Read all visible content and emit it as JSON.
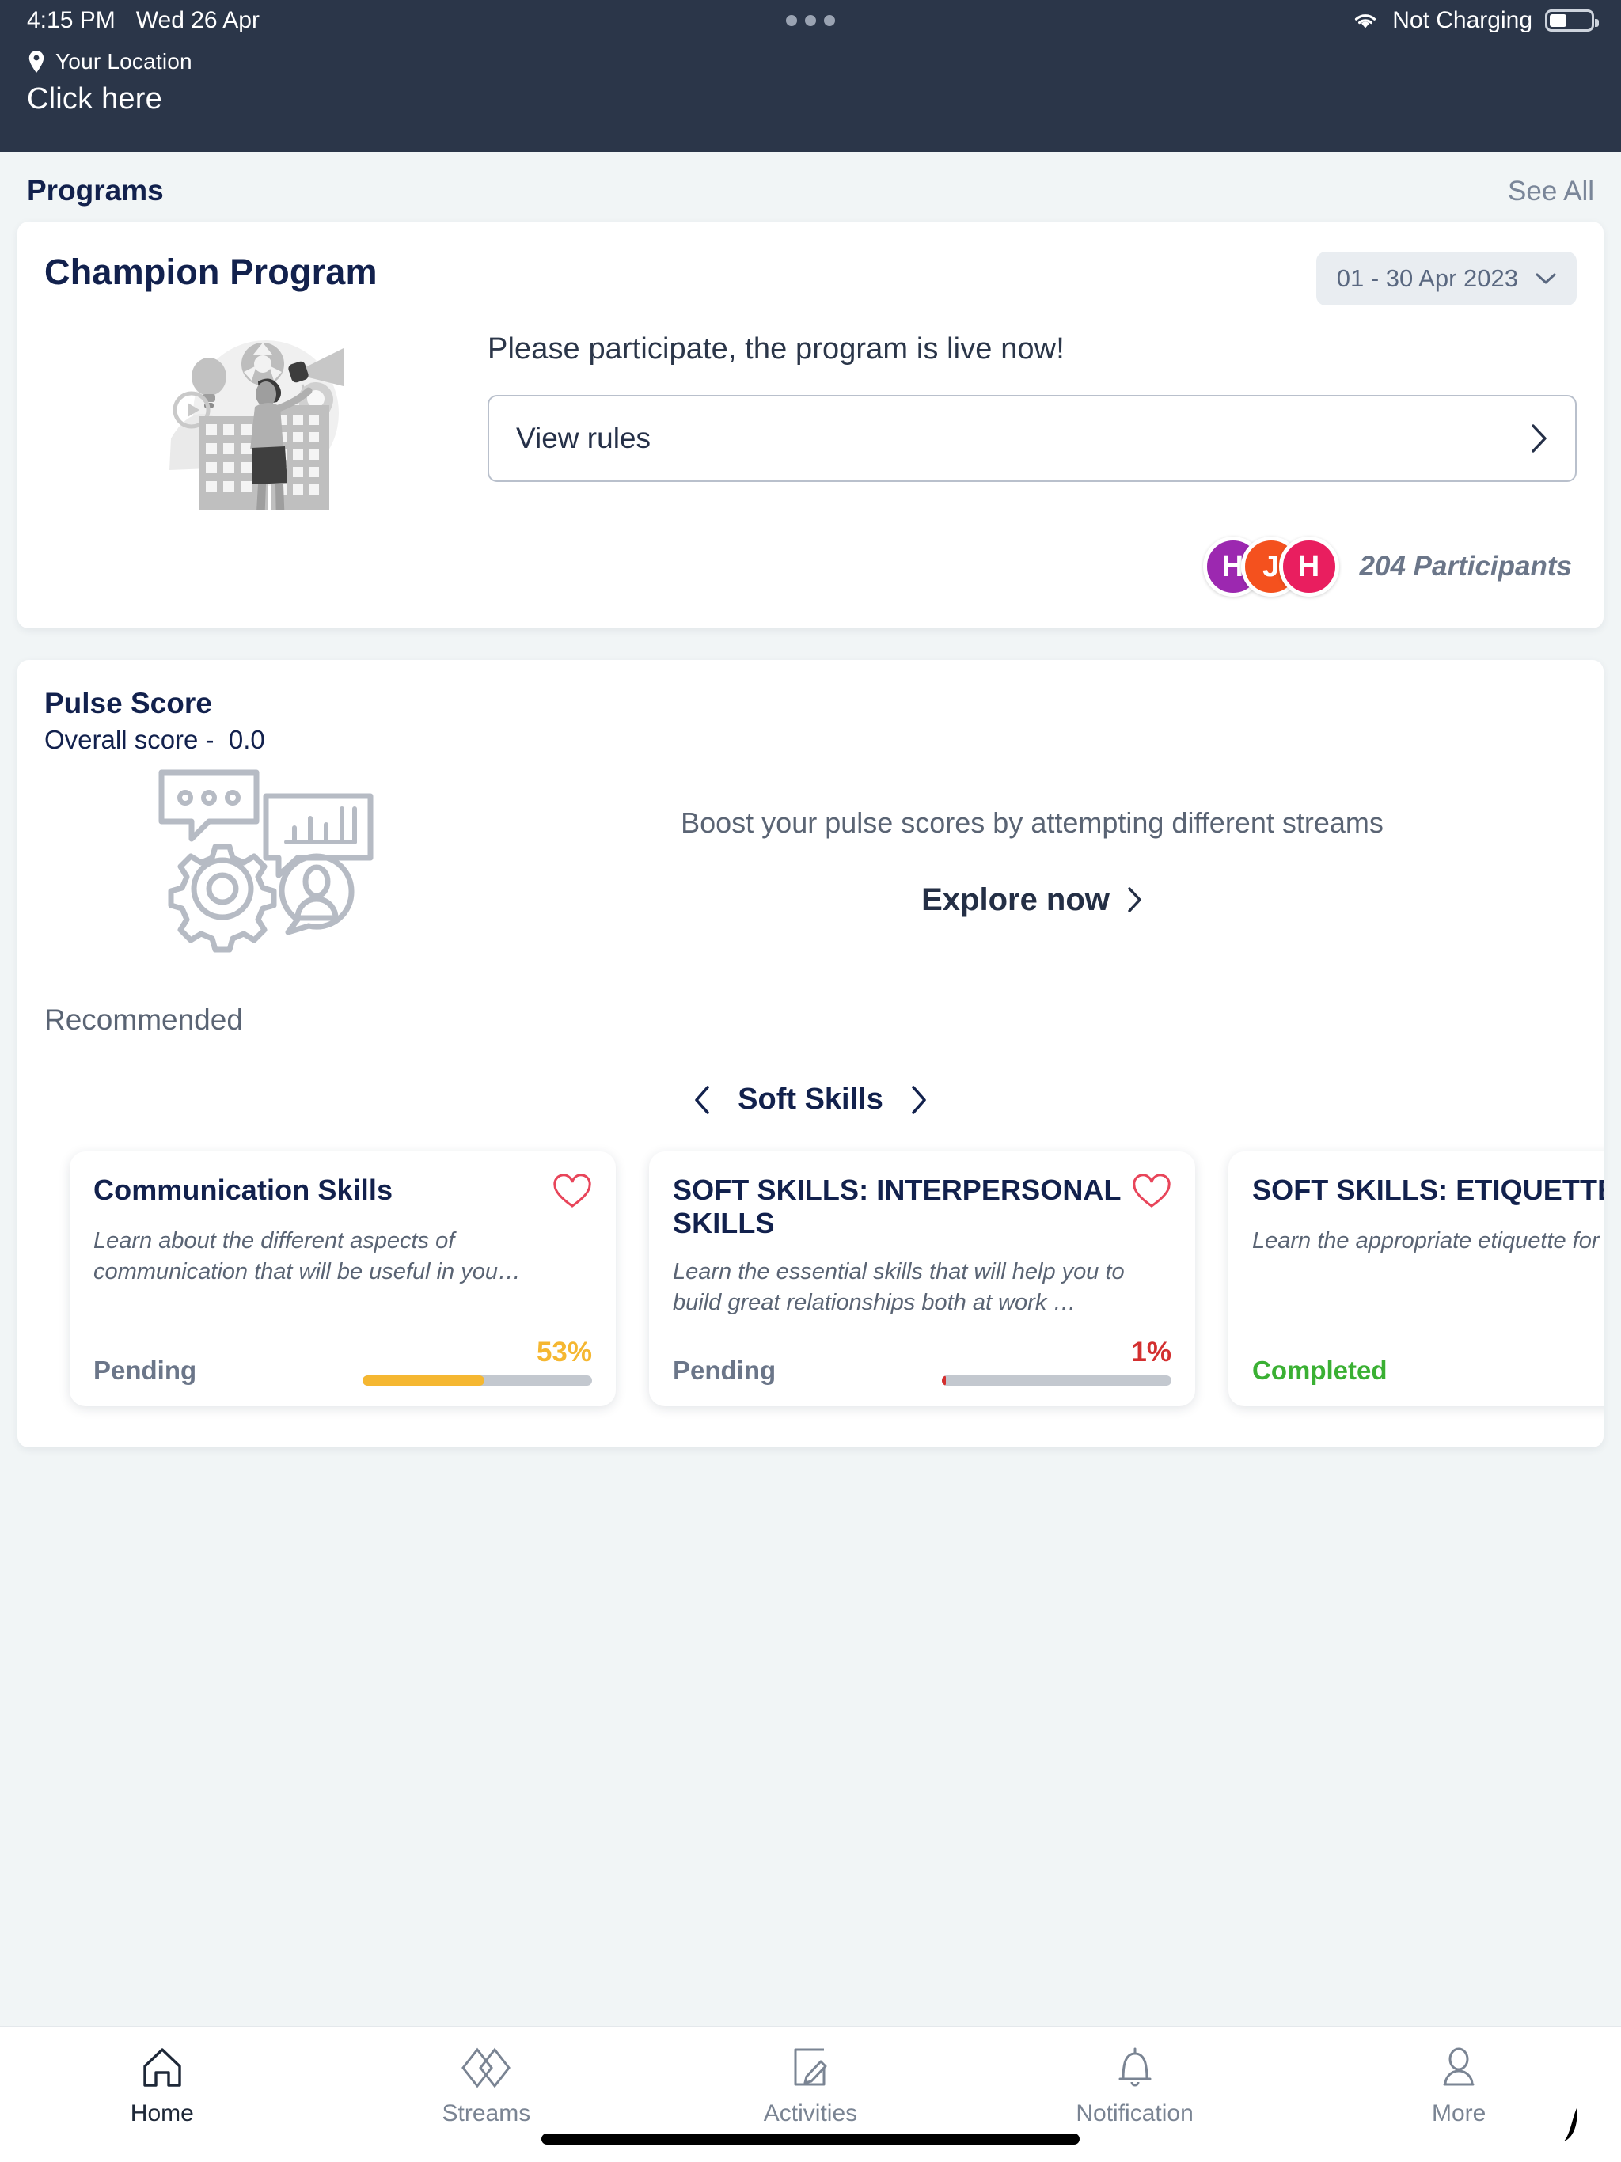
{
  "status_bar": {
    "time": "4:15 PM",
    "date": "Wed 26 Apr",
    "battery_text": "Not Charging",
    "wifi_icon": "wifi-icon",
    "battery_icon": "battery-icon",
    "menu_icon": "three-dots-icon"
  },
  "header": {
    "location_label": "Your Location",
    "location_value": "Click here",
    "pin_icon": "location-pin-icon"
  },
  "programs_section": {
    "title": "Programs",
    "see_all": "See All"
  },
  "champion_program": {
    "title": "Champion Program",
    "date_range": "01 - 30 Apr 2023",
    "chevron_icon": "chevron-down-icon",
    "illustration": "program-illustration",
    "lead": "Please participate, the program is live now!",
    "rules_label": "View rules",
    "rules_chevron": "chevron-right-icon",
    "participants_text": "204 Participants",
    "avatars": [
      {
        "initial": "H",
        "color": "#9c28b0"
      },
      {
        "initial": "J",
        "color": "#f4511e"
      },
      {
        "initial": "H",
        "color": "#e91e5f"
      }
    ]
  },
  "pulse_score": {
    "title": "Pulse Score",
    "overall_label": "Overall score -",
    "overall_value": "0.0",
    "illustration": "pulse-score-illustration",
    "lead": "Boost your pulse scores by attempting different streams",
    "explore_label": "Explore now",
    "explore_chevron": "chevron-right-icon",
    "recommended_label": "Recommended",
    "carousel": {
      "label": "Soft Skills",
      "prev_icon": "chevron-left-icon",
      "next_icon": "chevron-right-icon"
    },
    "courses": [
      {
        "title": "Communication Skills",
        "description": "Learn about the different aspects of communication that will be useful in you…",
        "status": "Pending",
        "status_type": "pending",
        "progress_text": "53%",
        "progress_value": 53,
        "progress_color": "#f5b731",
        "favorite_icon": "heart-outline-icon"
      },
      {
        "title": "SOFT SKILLS: INTERPERSONAL SKILLS",
        "description": "Learn the essential skills that will help you to build great relationships both at work …",
        "status": "Pending",
        "status_type": "pending",
        "progress_text": "1%",
        "progress_value": 1,
        "progress_color": "#d32f2f",
        "favorite_icon": "heart-outline-icon"
      },
      {
        "title": "SOFT SKILLS: ETIQUETTE",
        "description": "Learn the appropriate etiquette for situations.",
        "status": "Completed",
        "status_type": "completed",
        "progress_text": "",
        "progress_value": 0,
        "progress_color": "#3ab033",
        "favorite_icon": "heart-outline-icon"
      }
    ]
  },
  "tabbar": {
    "items": [
      {
        "label": "Home",
        "icon": "home-icon",
        "active": true
      },
      {
        "label": "Streams",
        "icon": "streams-diamonds-icon",
        "active": false
      },
      {
        "label": "Activities",
        "icon": "note-pencil-icon",
        "active": false
      },
      {
        "label": "Notification",
        "icon": "bell-icon",
        "active": false
      },
      {
        "label": "More",
        "icon": "person-icon",
        "active": false
      }
    ]
  }
}
